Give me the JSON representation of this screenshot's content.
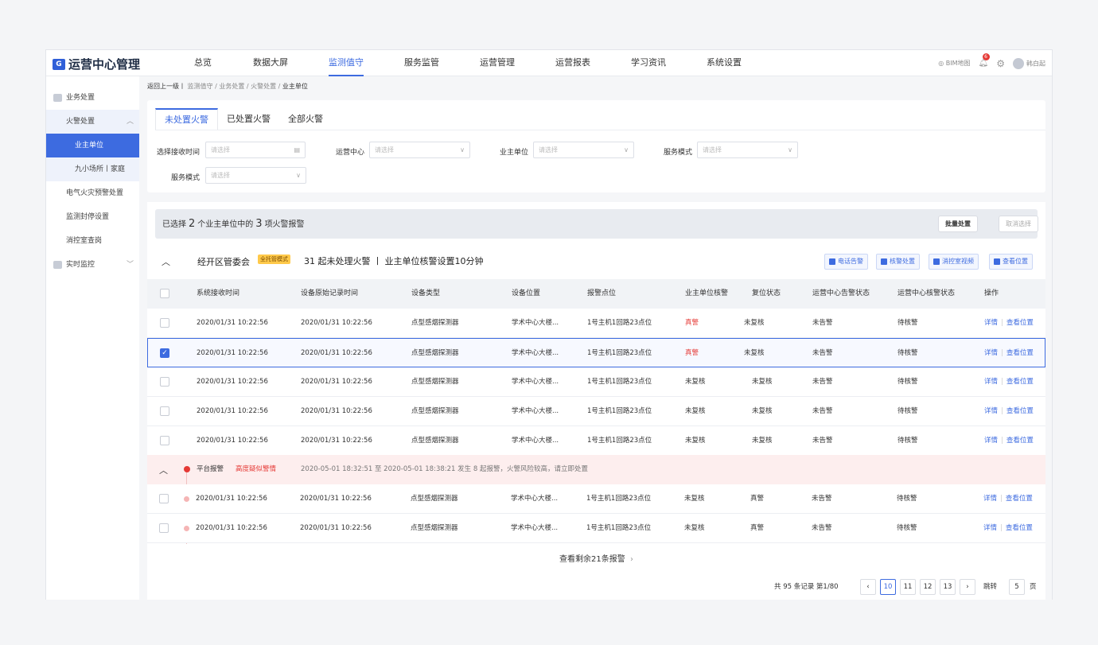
{
  "app": {
    "title": "运营中心管理",
    "logo_mark": "G"
  },
  "topnav": {
    "items": [
      "总览",
      "数据大屏",
      "监测值守",
      "服务监管",
      "运营管理",
      "运营报表",
      "学习资讯",
      "系统设置"
    ]
  },
  "topright": {
    "bim": "BIM地图",
    "badge": "6",
    "user": "韩白起"
  },
  "sidebar": {
    "items": [
      "业务处置",
      "火警处置",
      "业主单位",
      "九小场所丨家庭",
      "电气火灾预警处置",
      "监测封停设置",
      "消控室查岗",
      "实时监控"
    ]
  },
  "breadcrumb": {
    "back": "返回上一级丨",
    "path": "监测值守 / 业务处置 / 火警处置 / ",
    "current": "业主单位"
  },
  "filter": {
    "tabs": [
      "未处置火警",
      "已处置火警",
      "全部火警"
    ],
    "labels": [
      "选择接收时间",
      "运营中心",
      "业主单位",
      "服务模式",
      "服务模式"
    ],
    "placeholder": "请选择"
  },
  "selection": {
    "prefix": "已选择",
    "units": "2",
    "mid": "个业主单位中的",
    "alarms": "3",
    "suffix": "项火警报警",
    "batch": "批量处置",
    "cancel": "取消选择"
  },
  "group": {
    "title": "经开区管委会",
    "tag": "全托管模式",
    "info": "31  起未处理火警  丨  业主单位核警设置10分钟",
    "actions": [
      "电话告警",
      "核警处置",
      "消控室视频",
      "查看位置"
    ]
  },
  "table": {
    "headers": [
      "系统接收时间",
      "设备原始记录时间",
      "设备类型",
      "设备位置",
      "报警点位",
      "业主单位核警",
      "复位状态",
      "运营中心告警状态",
      "运营中心核警状态",
      "操作"
    ],
    "rows": [
      [
        "2020/01/31  10:22:56",
        "2020/01/31  10:22:56",
        "点型感烟探测器",
        "学术中心大楼...",
        "1号主机1回路23点位",
        "真警",
        "未复核",
        "未告警",
        "待核警"
      ],
      [
        "2020/01/31  10:22:56",
        "2020/01/31  10:22:56",
        "点型感烟探测器",
        "学术中心大楼...",
        "1号主机1回路23点位",
        "真警",
        "未复核",
        "未告警",
        "待核警"
      ],
      [
        "2020/01/31  10:22:56",
        "2020/01/31  10:22:56",
        "点型感烟探测器",
        "学术中心大楼...",
        "1号主机1回路23点位",
        "未复核",
        "未复核",
        "未告警",
        "待核警"
      ],
      [
        "2020/01/31  10:22:56",
        "2020/01/31  10:22:56",
        "点型感烟探测器",
        "学术中心大楼...",
        "1号主机1回路23点位",
        "未复核",
        "未复核",
        "未告警",
        "待核警"
      ],
      [
        "2020/01/31  10:22:56",
        "2020/01/31  10:22:56",
        "点型感烟探测器",
        "学术中心大楼...",
        "1号主机1回路23点位",
        "未复核",
        "未复核",
        "未告警",
        "待核警"
      ]
    ],
    "op_detail": "详情",
    "op_locate": "查看位置",
    "op_sep": "|"
  },
  "alarm": {
    "label": "平台报警",
    "level": "高度疑似警情",
    "message": "2020-05-01 18:32:51 至 2020-05-01 18:38:21 发生 8 起报警，火警风险较高，请立即处置",
    "rows": [
      [
        "2020/01/31  10:22:56",
        "2020/01/31  10:22:56",
        "点型感烟探测器",
        "学术中心大楼...",
        "1号主机1回路23点位",
        "未复核",
        "真警",
        "未告警",
        "待核警"
      ],
      [
        "2020/01/31  10:22:56",
        "2020/01/31  10:22:56",
        "点型感烟探测器",
        "学术中心大楼...",
        "1号主机1回路23点位",
        "未复核",
        "真警",
        "未告警",
        "待核警"
      ]
    ]
  },
  "more": "查看剩余21条报警",
  "pagination": {
    "info": "共 95 条记录 第1/80",
    "pages": [
      "10",
      "11",
      "12",
      "13"
    ],
    "jump_label": "跳转",
    "jump_value": "5",
    "page_unit": "页"
  },
  "colors": {
    "accent": "#3d6be0",
    "alert": "#e53935",
    "tag": "#ffc94a"
  }
}
